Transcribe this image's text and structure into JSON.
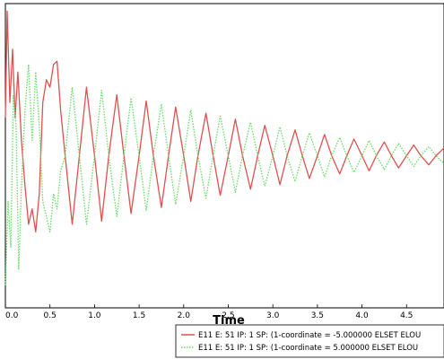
{
  "chart_data": {
    "type": "line",
    "title": "",
    "xlabel": "Time",
    "ylabel": "",
    "xlim": [
      0,
      4.92
    ],
    "ylim": [
      -1,
      1
    ],
    "x_ticks": [
      "0.0",
      "0.5",
      "1.0",
      "1.5",
      "2.0",
      "2.5",
      "3.0",
      "3.5",
      "4.0",
      "4.5"
    ],
    "x_tick_values": [
      0,
      0.5,
      1.0,
      1.5,
      2.0,
      2.5,
      3.0,
      3.5,
      4.0,
      4.5
    ],
    "grid": false,
    "legend_position": "bottom-right",
    "series": [
      {
        "name": "E11 E: 51 IP: 1 SP: (1-coordinate = -5.000000 ELSET ELOU",
        "color": "#e05050",
        "style": "solid",
        "x": [
          0.0,
          0.02,
          0.05,
          0.08,
          0.11,
          0.14,
          0.18,
          0.22,
          0.26,
          0.3,
          0.34,
          0.38,
          0.42,
          0.46,
          0.5,
          0.54,
          0.58,
          0.62,
          0.67,
          0.75,
          0.83,
          0.91,
          1.0,
          1.08,
          1.16,
          1.25,
          1.33,
          1.41,
          1.5,
          1.58,
          1.66,
          1.75,
          1.83,
          1.91,
          2.0,
          2.08,
          2.16,
          2.25,
          2.33,
          2.41,
          2.5,
          2.58,
          2.66,
          2.75,
          2.83,
          2.91,
          3.0,
          3.08,
          3.16,
          3.25,
          3.33,
          3.41,
          3.5,
          3.58,
          3.66,
          3.75,
          3.83,
          3.91,
          4.0,
          4.08,
          4.16,
          4.25,
          4.33,
          4.41,
          4.5,
          4.58,
          4.66,
          4.75,
          4.83,
          4.92
        ],
        "y": [
          0.25,
          0.95,
          0.35,
          0.7,
          0.25,
          0.55,
          0.1,
          -0.2,
          -0.45,
          -0.35,
          -0.5,
          -0.25,
          0.35,
          0.5,
          0.45,
          0.6,
          0.62,
          0.3,
          0.0,
          -0.45,
          0.0,
          0.45,
          0.0,
          -0.43,
          0.0,
          0.4,
          0.0,
          -0.38,
          0.0,
          0.36,
          0.0,
          -0.34,
          0.0,
          0.32,
          0.0,
          -0.3,
          0.0,
          0.28,
          0.0,
          -0.26,
          0.0,
          0.24,
          0.0,
          -0.22,
          0.0,
          0.2,
          0.0,
          -0.19,
          0.0,
          0.17,
          0.0,
          -0.15,
          0.0,
          0.14,
          0.0,
          -0.12,
          0.0,
          0.11,
          0.0,
          -0.1,
          0.0,
          0.09,
          0.0,
          -0.08,
          0.0,
          0.07,
          0.0,
          -0.06,
          0.0,
          0.05
        ]
      },
      {
        "name": "E11 E: 51 IP: 1 SP: (1-coordinate = 5.000000 ELSET ELOU",
        "color": "#66dd66",
        "style": "dotted",
        "x": [
          0.0,
          0.03,
          0.06,
          0.09,
          0.12,
          0.15,
          0.18,
          0.22,
          0.26,
          0.3,
          0.34,
          0.38,
          0.42,
          0.46,
          0.5,
          0.54,
          0.58,
          0.62,
          0.67,
          0.75,
          0.83,
          0.91,
          1.0,
          1.08,
          1.16,
          1.25,
          1.33,
          1.41,
          1.5,
          1.58,
          1.66,
          1.75,
          1.83,
          1.91,
          2.0,
          2.08,
          2.16,
          2.25,
          2.33,
          2.41,
          2.5,
          2.58,
          2.66,
          2.75,
          2.83,
          2.91,
          3.0,
          3.08,
          3.16,
          3.25,
          3.33,
          3.41,
          3.5,
          3.58,
          3.66,
          3.75,
          3.83,
          3.91,
          4.0,
          4.08,
          4.16,
          4.25,
          4.33,
          4.41,
          4.5,
          4.58,
          4.66,
          4.75,
          4.83,
          4.92
        ],
        "y": [
          -0.85,
          -0.3,
          -0.6,
          0.4,
          0.2,
          -0.75,
          -0.2,
          0.3,
          0.6,
          0.1,
          0.55,
          0.2,
          -0.3,
          -0.4,
          -0.5,
          -0.25,
          -0.35,
          -0.1,
          0.0,
          0.45,
          0.0,
          -0.45,
          0.0,
          0.43,
          0.0,
          -0.4,
          0.0,
          0.38,
          0.0,
          -0.36,
          0.0,
          0.34,
          0.0,
          -0.32,
          0.0,
          0.3,
          0.0,
          -0.28,
          0.0,
          0.26,
          0.0,
          -0.24,
          0.0,
          0.22,
          0.0,
          -0.2,
          0.0,
          0.19,
          0.0,
          -0.17,
          0.0,
          0.15,
          0.0,
          -0.14,
          0.0,
          0.12,
          0.0,
          -0.11,
          0.0,
          0.1,
          0.0,
          -0.09,
          0.0,
          0.08,
          0.0,
          -0.07,
          0.0,
          0.06,
          0.0,
          -0.05
        ]
      }
    ]
  }
}
